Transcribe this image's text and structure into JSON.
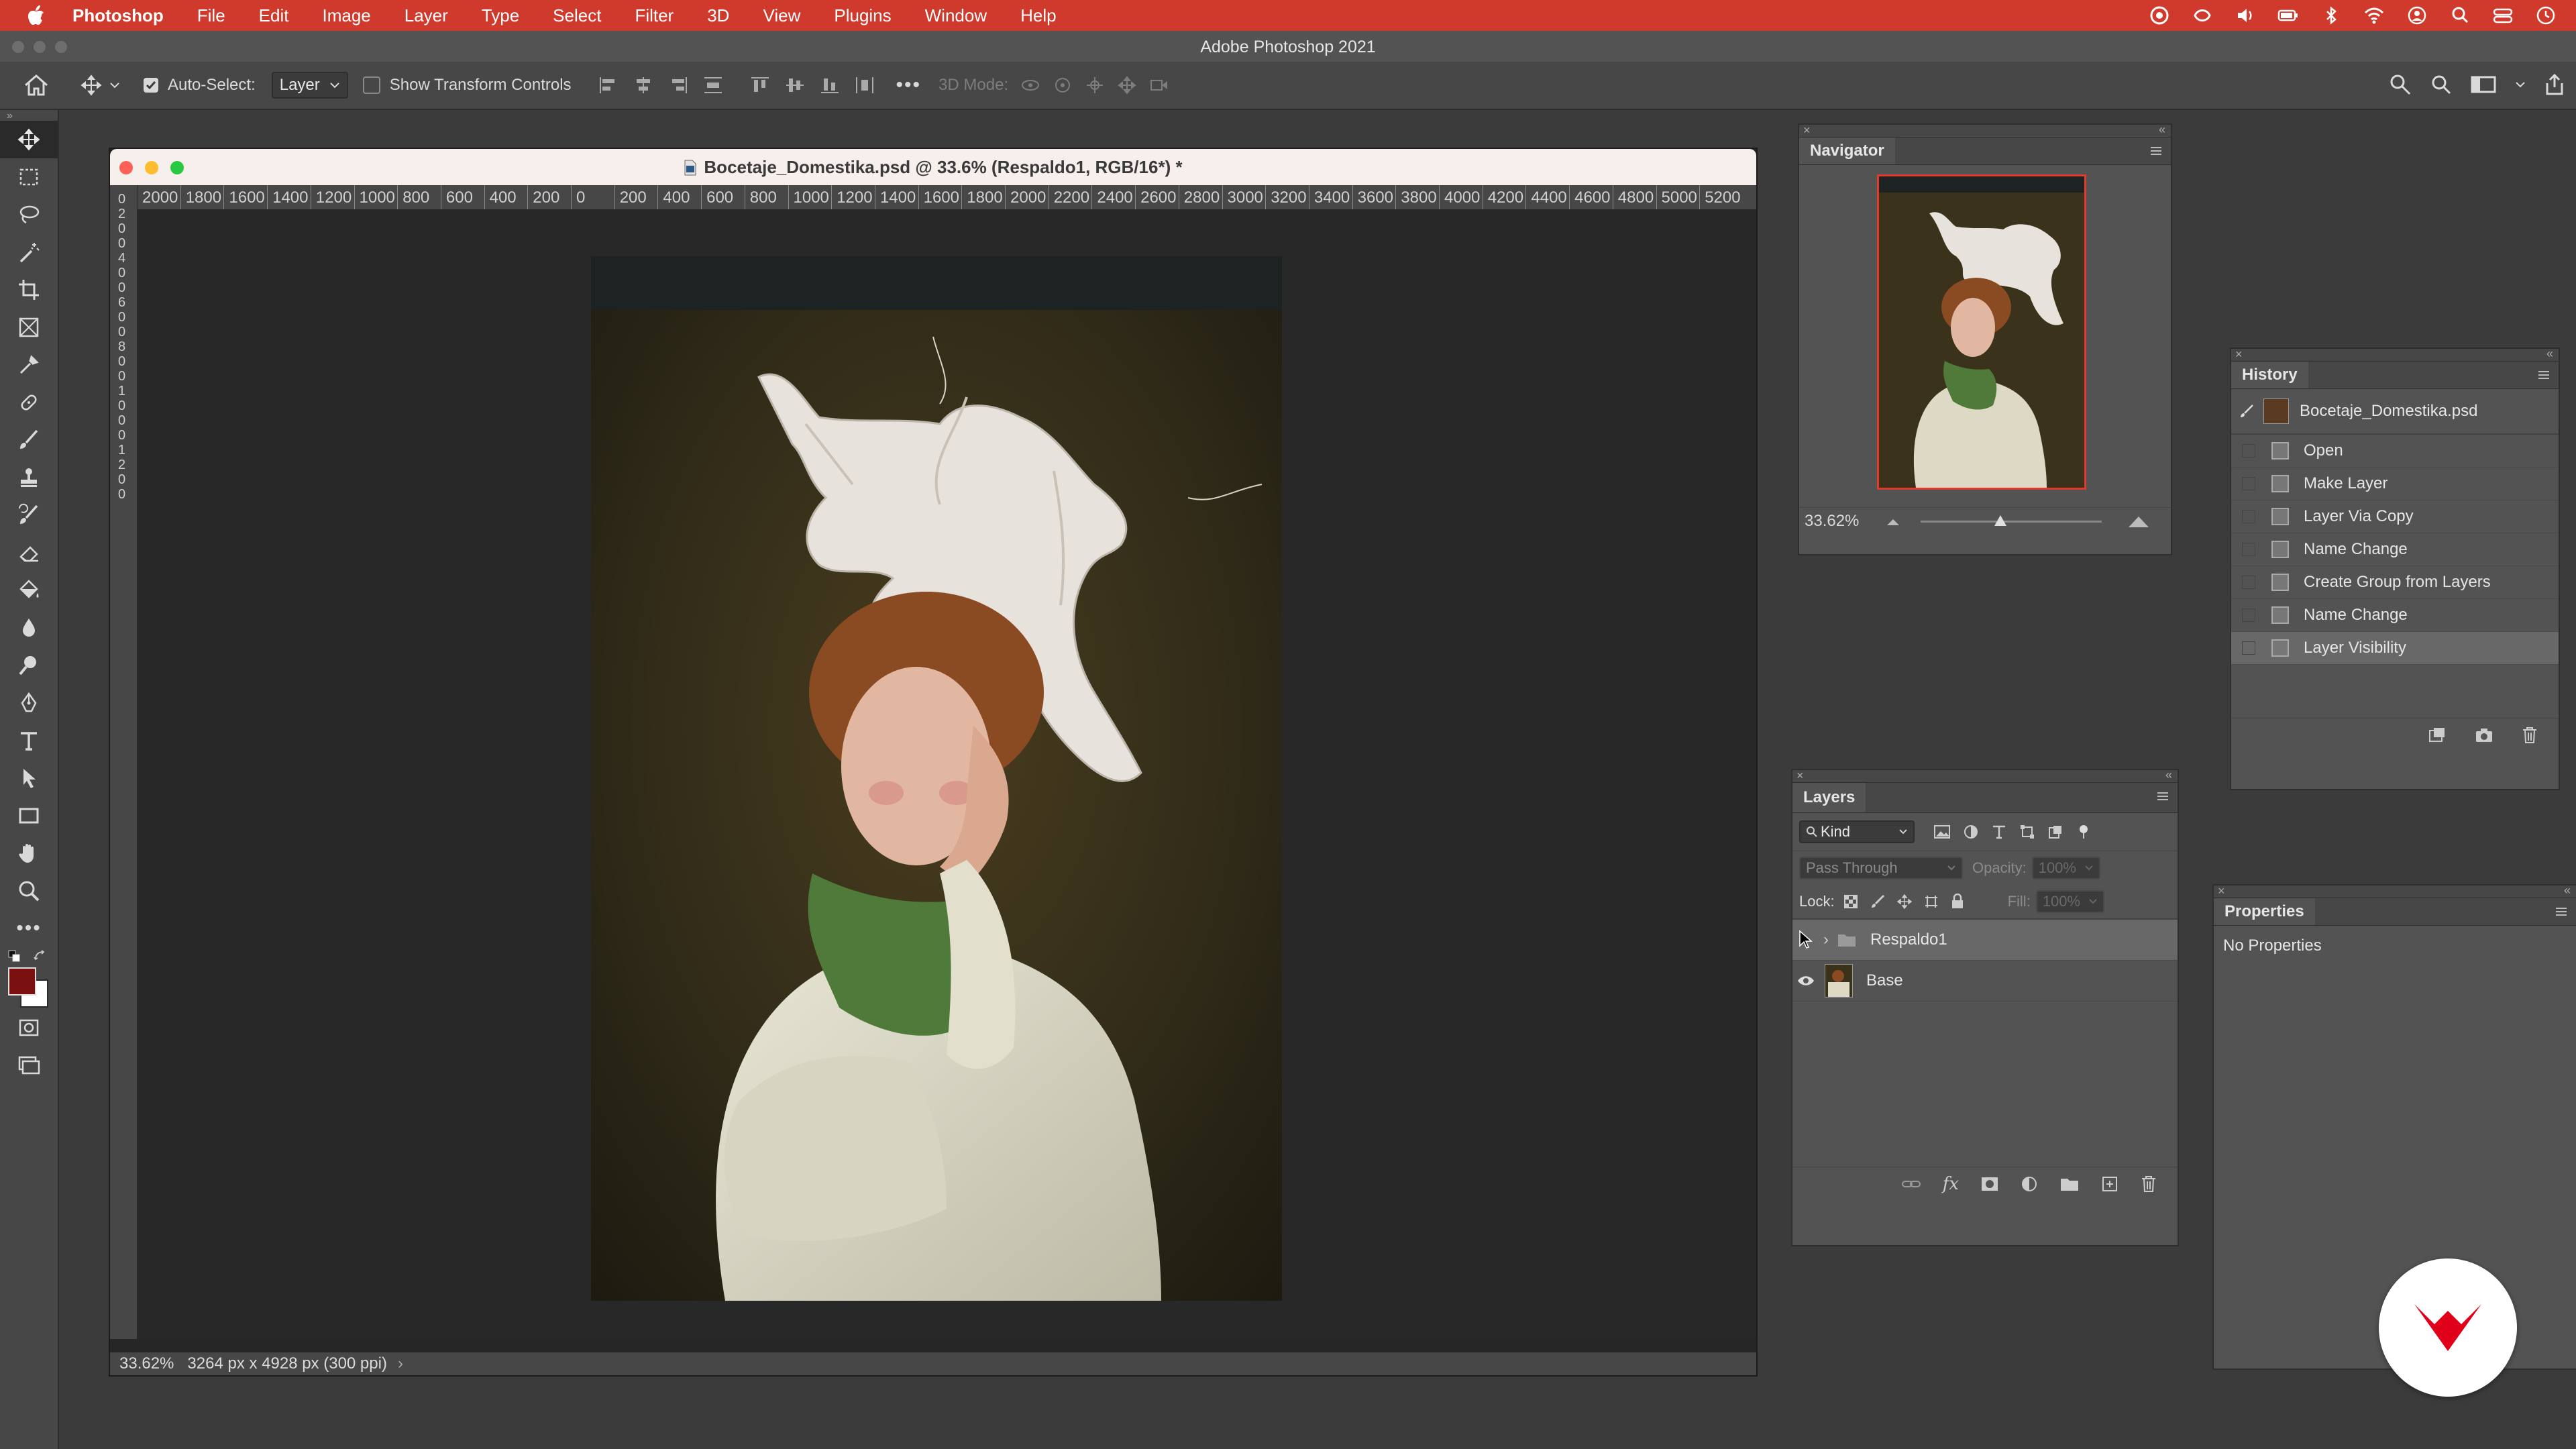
{
  "menubar": {
    "app": "Photoshop",
    "items": [
      "File",
      "Edit",
      "Image",
      "Layer",
      "Type",
      "Select",
      "Filter",
      "3D",
      "View",
      "Plugins",
      "Window",
      "Help"
    ],
    "status_icons": [
      "creative-cloud-icon",
      "siri-icon",
      "volume-icon",
      "battery-icon",
      "bluetooth-icon",
      "wifi-icon",
      "user-icon",
      "spotlight-icon",
      "control-center-icon",
      "clock-icon"
    ]
  },
  "window": {
    "title": "Adobe Photoshop 2021"
  },
  "options": {
    "auto_select_label": "Auto-Select:",
    "auto_select_checked": true,
    "auto_select_value": "Layer",
    "show_transform_label": "Show Transform Controls",
    "show_transform_checked": false,
    "mode3d_label": "3D Mode:"
  },
  "toolbar": {
    "tools": [
      "move-tool-icon",
      "marquee-tool-icon",
      "lasso-tool-icon",
      "magic-wand-icon",
      "crop-tool-icon",
      "frame-tool-icon",
      "eyedropper-icon",
      "spot-healing-icon",
      "brush-tool-icon",
      "clone-stamp-icon",
      "history-brush-icon",
      "eraser-icon",
      "paint-bucket-icon",
      "blur-tool-icon",
      "dodge-tool-icon",
      "pen-tool-icon",
      "type-tool-icon",
      "path-selection-icon",
      "rectangle-tool-icon",
      "hand-tool-icon",
      "zoom-tool-icon",
      "more-tools-icon"
    ],
    "foreground_color": "#7a1010",
    "background_color": "#ffffff"
  },
  "document": {
    "title": "Bocetaje_Domestika.psd @ 33.6% (Respaldo1, RGB/16*) *",
    "ruler_labels": [
      "2000",
      "1800",
      "1600",
      "1400",
      "1200",
      "1000",
      "800",
      "600",
      "400",
      "200",
      "0",
      "200",
      "400",
      "600",
      "800",
      "1000",
      "1200",
      "1400",
      "1600",
      "1800",
      "2000",
      "2200",
      "2400",
      "2600",
      "2800",
      "3000",
      "3200",
      "3400",
      "3600",
      "3800",
      "4000",
      "4200",
      "4400",
      "4600",
      "4800",
      "5000",
      "5200"
    ],
    "vruler_labels": [
      "0",
      "2",
      "0",
      "0",
      "4",
      "0",
      "0",
      "6",
      "0",
      "0",
      "8",
      "0",
      "0",
      "1",
      "0",
      "0",
      "0",
      "1",
      "2",
      "0",
      "0"
    ],
    "zoom": "33.62%",
    "info": "3264 px x 4928 px (300 ppi)",
    "status_arrow": "›"
  },
  "navigator": {
    "tab": "Navigator",
    "zoom": "33.62%",
    "zoom_slider": 0.44
  },
  "history": {
    "tab": "History",
    "snapshot": "Bocetaje_Domestika.psd",
    "states": [
      "Open",
      "Make Layer",
      "Layer Via Copy",
      "Name Change",
      "Create Group from Layers",
      "Name Change",
      "Layer Visibility"
    ],
    "selected_index": 6
  },
  "layers": {
    "tab": "Layers",
    "filter_kind": "Kind",
    "blend_mode": "Pass Through",
    "opacity_label": "Opacity:",
    "opacity_value": "100%",
    "lock_label": "Lock:",
    "fill_label": "Fill:",
    "fill_value": "100%",
    "items": [
      {
        "name": "Respaldo1",
        "type": "group",
        "visible": false,
        "selected": true
      },
      {
        "name": "Base",
        "type": "pixel",
        "visible": true,
        "selected": false
      }
    ]
  },
  "properties": {
    "tab": "Properties",
    "empty_text": "No Properties"
  },
  "overlay": {
    "logo": "domestika-logo-icon",
    "brand_color": "#e0001a"
  }
}
